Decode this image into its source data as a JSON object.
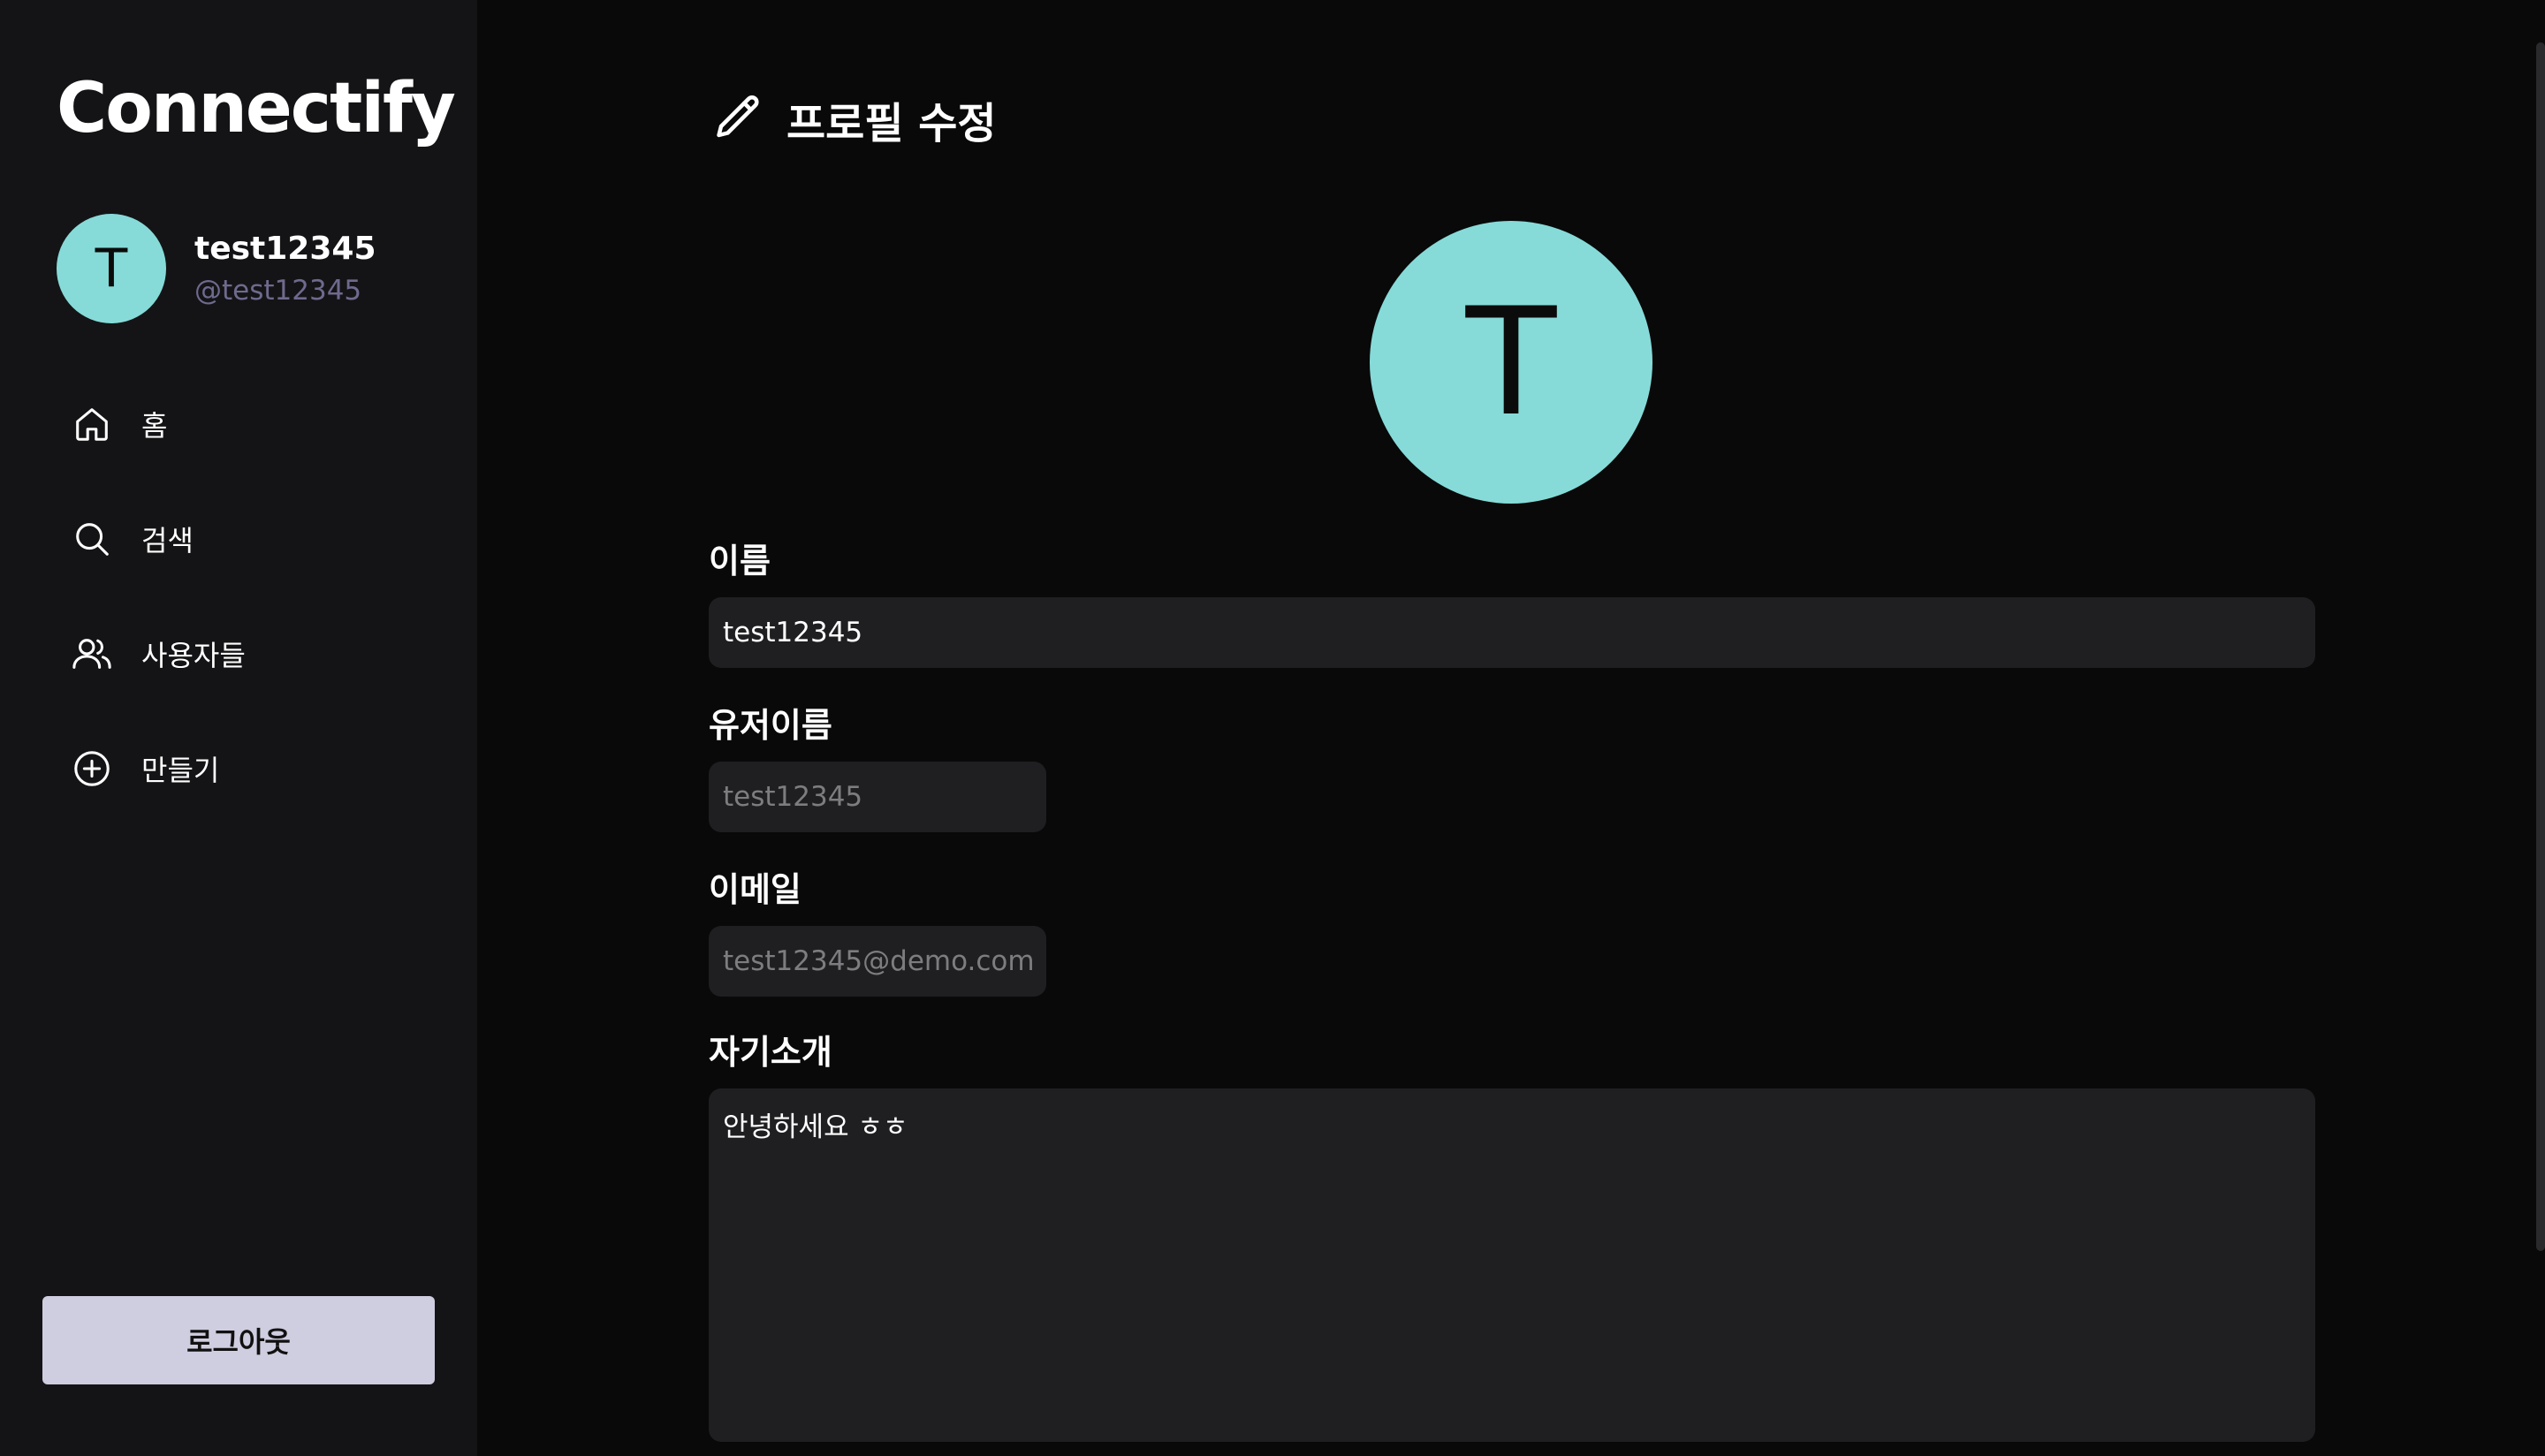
{
  "app": {
    "name": "Connectify"
  },
  "user": {
    "initial": "T",
    "display_name": "test12345",
    "handle": "@test12345"
  },
  "nav": {
    "items": [
      {
        "label": "홈",
        "icon": "home-icon"
      },
      {
        "label": "검색",
        "icon": "search-icon"
      },
      {
        "label": "사용자들",
        "icon": "users-icon"
      },
      {
        "label": "만들기",
        "icon": "plus-circle-icon"
      }
    ]
  },
  "logout": {
    "label": "로그아웃"
  },
  "page": {
    "title": "프로필 수정",
    "title_icon": "pencil-icon"
  },
  "form": {
    "avatar_initial": "T",
    "name": {
      "label": "이름",
      "value": "test12345"
    },
    "username": {
      "label": "유저이름",
      "value": "test12345"
    },
    "email": {
      "label": "이메일",
      "value": "test12345@demo.com"
    },
    "bio": {
      "label": "자기소개",
      "value": "안녕하세요 ㅎㅎ"
    }
  },
  "colors": {
    "background": "#09090a",
    "sidebar": "#141416",
    "avatar": "#86dbd8",
    "input_bg": "#1f1f22",
    "handle_text": "#6e6a8e",
    "logout_bg": "#cfcde0"
  }
}
